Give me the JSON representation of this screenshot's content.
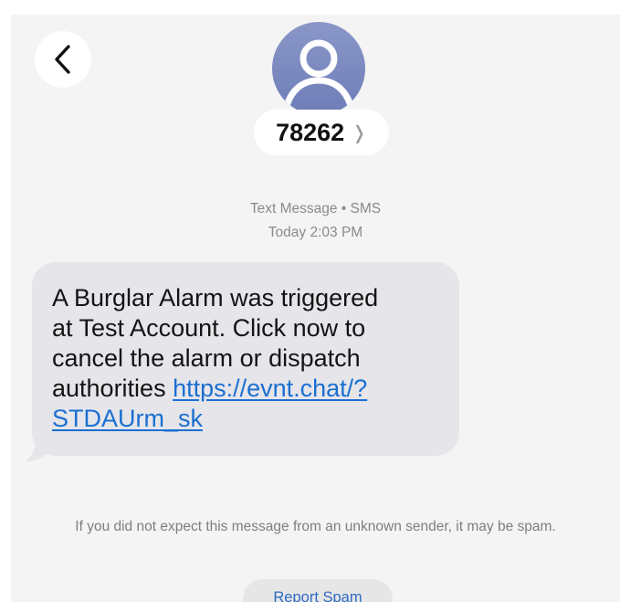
{
  "header": {
    "back_icon": "chevron-left-icon",
    "avatar_icon": "person-silhouette-icon",
    "sender": "78262",
    "sender_chevron_icon": "chevron-right-icon"
  },
  "thread": {
    "service_label": "Text Message • SMS",
    "timestamp": "Today 2:03 PM"
  },
  "message": {
    "text_lines": [
      "A Burglar Alarm  was triggered",
      "at Test Account. Click now to",
      "cancel the alarm or dispatch",
      "authorities "
    ],
    "link_lines": [
      "https://evnt.chat/?",
      "STDAUrm_sk"
    ],
    "bubble_color": "#e5e5ea",
    "link_color": "#1b6fd1"
  },
  "footer": {
    "spam_warning": "If you did not expect this message from an unknown sender, it may be spam.",
    "report_spam_label": "Report Spam"
  },
  "colors": {
    "background": "#f4f4f4",
    "avatar": "#7b89bf",
    "accent": "#2f6bc4"
  }
}
